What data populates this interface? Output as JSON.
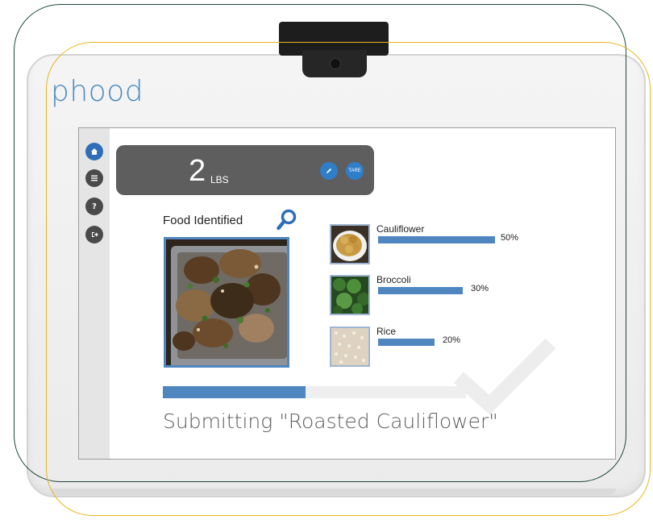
{
  "brand": "phood",
  "scale": {
    "weight_value": "2",
    "weight_unit": "LBS",
    "tare_label": "TARE"
  },
  "nav": [
    {
      "icon": "home-icon"
    },
    {
      "icon": "list-icon"
    },
    {
      "icon": "help-icon"
    },
    {
      "icon": "logout-icon"
    }
  ],
  "food_identified": {
    "title": "Food Identified",
    "photo": "roasted-cauliflower-tray"
  },
  "results": [
    {
      "name": "Cauliflower",
      "percent_label": "50%",
      "fraction": 0.5
    },
    {
      "name": "Broccoli",
      "percent_label": "30%",
      "fraction": 0.3
    },
    {
      "name": "Rice",
      "percent_label": "20%",
      "fraction": 0.2
    }
  ],
  "progress": {
    "fraction": 0.47
  },
  "status_text": "Submitting \"Roasted Cauliflower\"",
  "colors": {
    "accent": "#4f86c0",
    "button": "#2f7ec9",
    "brand": "#4b8bbd",
    "frame_green": "#1f4a36",
    "frame_yellow": "#e6b61c"
  }
}
